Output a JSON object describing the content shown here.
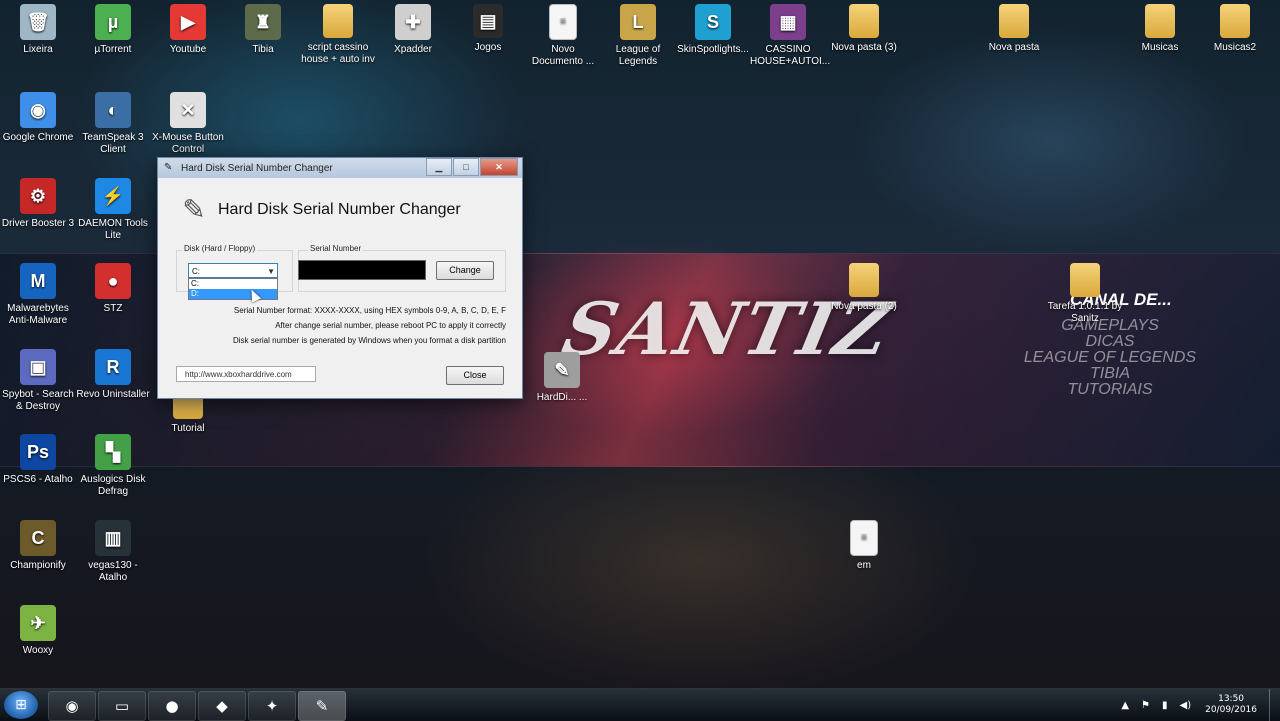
{
  "desktop": {
    "icons": [
      {
        "label": "Lixeira",
        "icon": "recycle-bin-icon",
        "glyph": "🗑"
      },
      {
        "label": "µTorrent",
        "icon": "utorrent-icon",
        "glyph": "µ"
      },
      {
        "label": "Youtube",
        "icon": "youtube-icon",
        "glyph": "▶"
      },
      {
        "label": "Tibia",
        "icon": "tibia-icon",
        "glyph": "♜"
      },
      {
        "label": "script cassino house + auto inv",
        "icon": "folder-icon",
        "glyph": ""
      },
      {
        "label": "Xpadder",
        "icon": "gamepad-icon",
        "glyph": "✚"
      },
      {
        "label": "Jogos",
        "icon": "folder-dark-icon",
        "glyph": "▤"
      },
      {
        "label": "Novo Documento ...",
        "icon": "document-icon",
        "glyph": "≡"
      },
      {
        "label": "League of Legends",
        "icon": "league-icon",
        "glyph": "L"
      },
      {
        "label": "SkinSpotlights...",
        "icon": "skinspotlights-icon",
        "glyph": "S"
      },
      {
        "label": "CASSINO HOUSE+AUTOI...",
        "icon": "winrar-icon",
        "glyph": "▦"
      },
      {
        "label": "Nova pasta (3)",
        "icon": "folder-icon",
        "glyph": ""
      },
      {
        "label": "Nova pasta",
        "icon": "folder-icon",
        "glyph": ""
      },
      {
        "label": "Musicas",
        "icon": "folder-icon",
        "glyph": ""
      },
      {
        "label": "Musicas2",
        "icon": "folder-icon",
        "glyph": ""
      },
      {
        "label": "Google Chrome",
        "icon": "chrome-icon",
        "glyph": "◉"
      },
      {
        "label": "TeamSpeak 3 Client",
        "icon": "teamspeak-icon",
        "glyph": "◐"
      },
      {
        "label": "X-Mouse Button Control",
        "icon": "mouse-icon",
        "glyph": "✕"
      },
      {
        "label": "Driver Booster 3",
        "icon": "driver-booster-icon",
        "glyph": "⚙"
      },
      {
        "label": "DAEMON Tools Lite",
        "icon": "daemon-tools-icon",
        "glyph": "⚡"
      },
      {
        "label": "Malwarebytes Anti-Malware",
        "icon": "malwarebytes-icon",
        "glyph": "M"
      },
      {
        "label": "STZ",
        "icon": "stz-icon",
        "glyph": "●"
      },
      {
        "label": "Spybot - Search & Destroy",
        "icon": "spybot-icon",
        "glyph": "▣"
      },
      {
        "label": "Revo Uninstaller",
        "icon": "revo-uninstaller-icon",
        "glyph": "R"
      },
      {
        "label": "Tutorial",
        "icon": "folder-icon",
        "glyph": ""
      },
      {
        "label": "PSCS6 - Atalho",
        "icon": "photoshop-icon",
        "glyph": "Ps"
      },
      {
        "label": "Auslogics Disk Defrag",
        "icon": "defrag-icon",
        "glyph": "▚"
      },
      {
        "label": "Championify",
        "icon": "championify-icon",
        "glyph": "C"
      },
      {
        "label": "vegas130 - Atalho",
        "icon": "vegas-icon",
        "glyph": "▥"
      },
      {
        "label": "Wooxy",
        "icon": "wooxy-icon",
        "glyph": "✈"
      },
      {
        "label": "Nova pasta (2)",
        "icon": "folder-icon",
        "glyph": ""
      },
      {
        "label": "Tarefa 1.0.1.1 by Sanitz",
        "icon": "folder-icon",
        "glyph": ""
      },
      {
        "label": "HardDi... ...",
        "icon": "hdd-tool-icon",
        "glyph": "✎"
      },
      {
        "label": "em",
        "icon": "document-icon",
        "glyph": "≡"
      }
    ]
  },
  "banner": {
    "logo": "SANTIZ",
    "canal": "CANAL DE...",
    "lines": [
      "GAMEPLAYS",
      "DICAS",
      "LEAGUE OF LEGENDS",
      "TIBIA",
      "TUTORIAIS"
    ]
  },
  "dialog": {
    "window_title": "Hard Disk Serial Number Changer",
    "header_title": "Hard Disk Serial Number Changer",
    "disk_label": "Disk (Hard / Floppy)",
    "serial_label": "Serial Number",
    "selected_disk": "C:",
    "dropdown_options": [
      "C:",
      "D:"
    ],
    "highlighted_option": "D:",
    "change_button": "Change",
    "info_lines": [
      "Serial Number format: XXXX-XXXX, using HEX symbols 0-9, A, B, C, D, E, F",
      "After change serial number, please reboot PC to apply it correctly",
      "Disk serial number is generated by Windows when you format a disk partition"
    ],
    "url": "http://www.xboxharddrive.com",
    "close_button": "Close",
    "min_glyph": "▁",
    "max_glyph": "□",
    "close_glyph": "✕"
  },
  "taskbar": {
    "start_glyph": "⊞",
    "items": [
      {
        "name": "taskbar-chrome",
        "glyph": "◉",
        "active": false
      },
      {
        "name": "taskbar-explorer",
        "glyph": "▭",
        "active": false
      },
      {
        "name": "taskbar-stz",
        "glyph": "●",
        "active": false
      },
      {
        "name": "taskbar-app-red",
        "glyph": "◆",
        "active": false
      },
      {
        "name": "taskbar-app-gold",
        "glyph": "✦",
        "active": false
      },
      {
        "name": "taskbar-hdd-tool",
        "glyph": "✎",
        "active": true
      }
    ],
    "tray": {
      "arrow": "▲",
      "flag": "⚑",
      "network": "▮",
      "volume": "◀)",
      "time": "13:50",
      "date": "20/09/2016"
    }
  }
}
